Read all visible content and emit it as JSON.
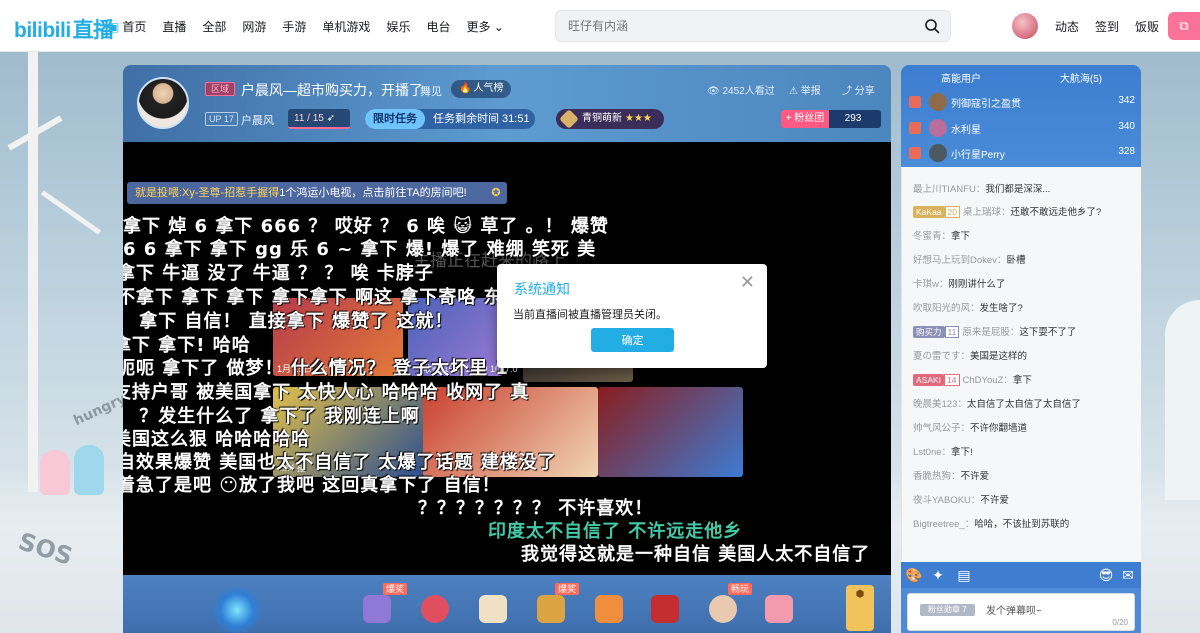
{
  "nav": {
    "logo_text": "bilibili",
    "logo_live": "直播",
    "items": [
      {
        "label": "首页",
        "icon": "tv-icon"
      },
      {
        "label": "直播"
      },
      {
        "label": "全部"
      },
      {
        "label": "网游"
      },
      {
        "label": "手游"
      },
      {
        "label": "单机游戏"
      },
      {
        "label": "娱乐"
      },
      {
        "label": "电台"
      },
      {
        "label": "更多"
      }
    ],
    "search_placeholder": "旺仔有内涵",
    "right_links": [
      "动态",
      "签到",
      "饭贩"
    ]
  },
  "room": {
    "area_tag": "区域",
    "title": "户晨风—超市购买力，开播了",
    "category": "舞见",
    "popular": "人气榜",
    "level": "UP 17",
    "streamer": "户晨风",
    "fans_ratio": "11 / 15",
    "task_label": "限时任务",
    "task_timer": "任务剩余时间 31:51",
    "rank_badge": "青铜萌新",
    "rank_stars": "★★★",
    "viewers": "2452人看过",
    "report": "举报",
    "share": "分享",
    "fan_club_label": "+ 粉丝团",
    "fan_club_count": "293"
  },
  "video": {
    "pin_notice_prefix": "就是",
    "pin_notice_name": "投喂:Xy-圣尊-招惹手握得",
    "pin_notice_text": "1个鸿运小电视，点击前往TA的房间吧!",
    "background_text": "主播正在赶来的路上",
    "danmaku": [
      {
        "text": "拿下    焯    6 拿下  666   ？  哎好 ？      6     唉    😺     草了   。！   爆赞",
        "color": "w"
      },
      {
        "text": "6    6 拿下 拿下      gg 乐   6      ~     拿下    爆!   爆了     难绷       笑死    美",
        "color": "w"
      },
      {
        "text": "拿下 牛逼 没了 牛逼    ？ ？      唉                                              卡脖子",
        "color": "w"
      },
      {
        "text": "不拿下 拿下  拿下 拿下拿下 啊这  拿下寄咯                              东房了    啊呵呵",
        "color": "w"
      },
      {
        "text": "？   拿下    自信！   直接拿下      爆赞了                                               这就！",
        "color": "w"
      },
      {
        "text": "拿下  拿下!                                                                                   哈哈",
        "color": "w"
      },
      {
        "text": "呃呃 拿下了    做梦！  什么情况？                                        登子太坏里    1",
        "color": "w"
      },
      {
        "text": "支持户哥         被美国拿下      太快人心        哈哈哈            收网了                  真",
        "color": "w"
      },
      {
        "text": "！          ？发生什么了                      拿下了     我刚连上啊                        ",
        "color": "w"
      },
      {
        "text": "                            美国这么狠              哈哈哈哈哈                          ",
        "color": "w"
      },
      {
        "text": "自效果爆赞              美国也太不自信了              太爆了话题           建楼没了",
        "color": "w"
      },
      {
        "text": "着急了是吧                                   😶放了我吧      这回真拿下了       自信！",
        "color": "w"
      },
      {
        "text": "？？？？？？？                  不许喜欢！",
        "color": "w"
      },
      {
        "text": "印度太不自信了           不许远走他乡",
        "color": "g"
      },
      {
        "text": "我觉得这就是一种自信    美国人太不自信了",
        "color": "w"
      }
    ],
    "thumb_captions": [
      "1月 15日 17:",
      "3.14 播",
      "收藏 15日  17:00 1017:0"
    ],
    "gift_tags": [
      "爆奖",
      "爆奖",
      "畅玩"
    ]
  },
  "modal": {
    "title": "系统通知",
    "message": "当前直播间被直播管理员关闭。",
    "ok_label": "确定",
    "close_symbol": "✕"
  },
  "side": {
    "tabs": [
      "高能用户",
      "大航海(5)"
    ],
    "ranks": [
      {
        "name": "列御寇引之盈贯",
        "score": "342",
        "color": "#8f6b4a"
      },
      {
        "name": "水利星",
        "score": "340",
        "color": "#b86d9c"
      },
      {
        "name": "小行星Perry",
        "score": "328",
        "color": "#4d5960"
      }
    ],
    "chat": [
      {
        "user": "最上川TIANFU：",
        "text": "我们都是深深..."
      },
      {
        "user": "桌上瑞球：",
        "text": "还敢不敢远走他乡了?",
        "badge": "KaKaa",
        "lv": "20",
        "badge_color": "#d9b35b"
      },
      {
        "user": "冬蜜青：",
        "text": "拿下"
      },
      {
        "user": "好想马上玩到Dokev：",
        "text": "卧槽"
      },
      {
        "user": "卡琪w：",
        "text": "刚刚讲什么了"
      },
      {
        "user": "吹取阳光的风：",
        "text": "发生啥了?"
      },
      {
        "user": "原来是屁股：",
        "text": "这下耍不了了",
        "badge": "购买力",
        "lv": "11",
        "badge_color": "#8c8fb8"
      },
      {
        "user": "夏の雷です：",
        "text": "美国是这样的"
      },
      {
        "user": "ChDYouZ：",
        "text": "拿下",
        "badge": "ASAKI",
        "lv": "14",
        "badge_color": "#e2687b"
      },
      {
        "user": "晚晨美123：",
        "text": "太自信了太自信了太自信了"
      },
      {
        "user": "帅气风公子：",
        "text": "不许你翻墙道"
      },
      {
        "user": "Lst0ne：",
        "text": "拿下!"
      },
      {
        "user": "香脆热狗：",
        "text": "不许爱"
      },
      {
        "user": "夜斗YABOKU：",
        "text": "不许爱"
      },
      {
        "user": "Bigtreetree_：",
        "text": "哈哈，不该扯到苏联的"
      }
    ],
    "input_medal": "粉丝勋章",
    "input_medal_lv": "7",
    "input_placeholder": "发个弹幕呗~",
    "input_count": "0/20"
  }
}
